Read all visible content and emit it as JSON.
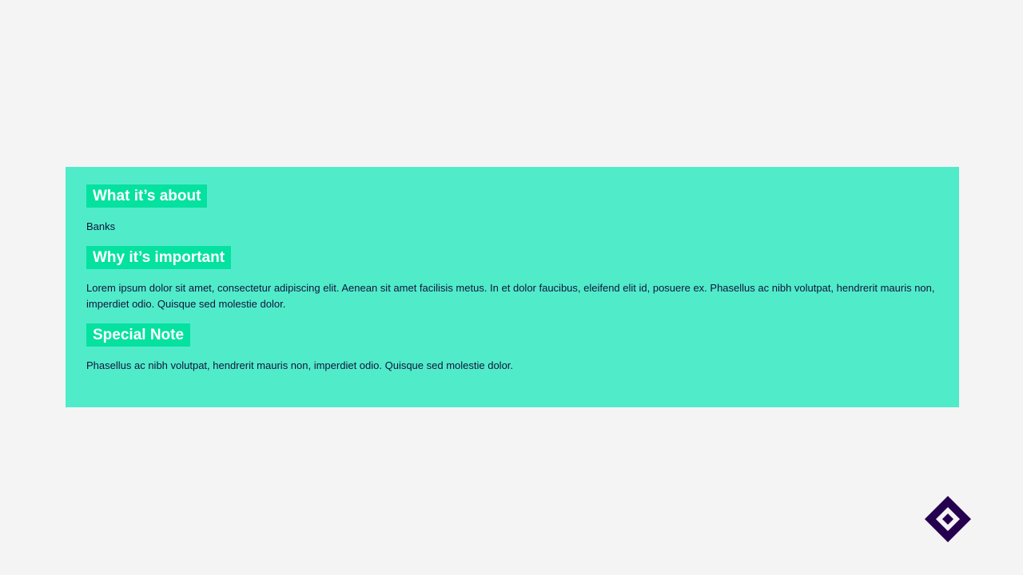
{
  "sections": [
    {
      "heading": "What it’s about",
      "body": "Banks"
    },
    {
      "heading": "Why it’s important",
      "body": "Lorem ipsum dolor sit amet, consectetur adipiscing elit. Aenean sit amet facilisis metus. In et dolor faucibus, eleifend elit id, posuere ex. Phasellus ac nibh volutpat, hendrerit mauris non, imperdiet odio. Quisque sed molestie dolor."
    },
    {
      "heading": "Special Note",
      "body": "Phasellus ac nibh volutpat, hendrerit mauris non, imperdiet odio. Quisque sed molestie dolor."
    }
  ],
  "colors": {
    "page_background": "#f4f4f4",
    "card_background": "#50ecca",
    "heading_background": "#05e19f",
    "heading_text": "#ffffff",
    "body_text": "#13143b",
    "logo": "#24004f"
  },
  "logo": {
    "icon": "diamond-logo-icon"
  }
}
